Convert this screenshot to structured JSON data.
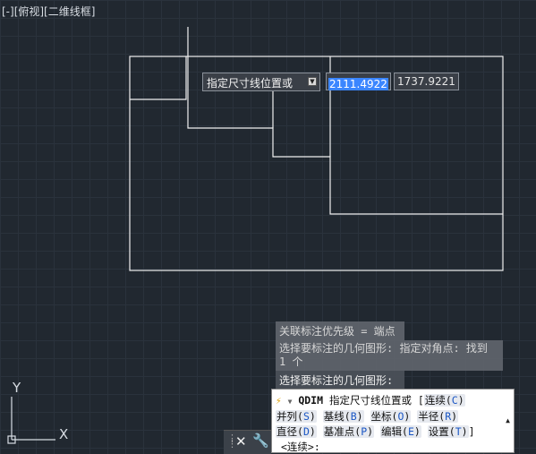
{
  "viewport": {
    "label": "[-][俯视][二维线框]"
  },
  "dynamic_input": {
    "prompt": "指定尺寸线位置或",
    "value1": "2111.4922",
    "value2": "1737.9221"
  },
  "history": {
    "line1": "关联标注优先级 = 端点",
    "line2": "选择要标注的几何图形: 指定对角点: 找到 1 个",
    "line3": "选择要标注的几何图形:"
  },
  "command": {
    "name": "QDIM",
    "prompt": "指定尺寸线位置或",
    "options": [
      {
        "label": "连续",
        "key": "C"
      },
      {
        "label": "并列",
        "key": "S"
      },
      {
        "label": "基线",
        "key": "B"
      },
      {
        "label": "坐标",
        "key": "O"
      },
      {
        "label": "半径",
        "key": "R"
      },
      {
        "label": "直径",
        "key": "D"
      },
      {
        "label": "基准点",
        "key": "P"
      },
      {
        "label": "编辑",
        "key": "E"
      },
      {
        "label": "设置",
        "key": "T"
      }
    ],
    "current": "<连续>:"
  },
  "ucs": {
    "x_label": "X",
    "y_label": "Y"
  },
  "icons": [
    "lightning-icon",
    "dropdown-caret-icon",
    "close-icon",
    "wrench-icon",
    "scroll-up-icon",
    "grip-icon"
  ]
}
